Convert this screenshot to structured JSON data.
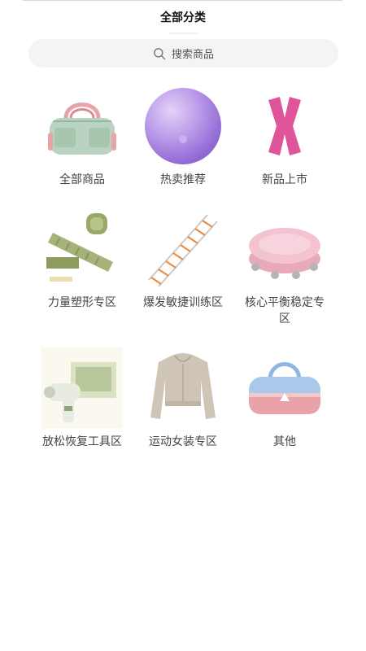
{
  "header": {
    "title": "全部分类"
  },
  "search": {
    "placeholder": "搜索商品",
    "icon": "search-icon"
  },
  "categories": [
    {
      "label": "全部商品",
      "icon": "duffel-bag-green"
    },
    {
      "label": "热卖推荐",
      "icon": "yoga-ball-purple"
    },
    {
      "label": "新品上市",
      "icon": "kinesiology-tape-pink"
    },
    {
      "label": "力量塑形专区",
      "icon": "ankle-weights-green"
    },
    {
      "label": "爆发敏捷训练区",
      "icon": "agility-ladder"
    },
    {
      "label": "核心平衡稳定专区",
      "icon": "balance-board-pink"
    },
    {
      "label": "放松恢复工具区",
      "icon": "massage-gun"
    },
    {
      "label": "运动女装专区",
      "icon": "cropped-hoodie"
    },
    {
      "label": "其他",
      "icon": "gym-bag-blue-pink"
    }
  ],
  "colors": {
    "background": "#ffffff",
    "search_bg": "#f4f4f4",
    "text": "#444444"
  }
}
